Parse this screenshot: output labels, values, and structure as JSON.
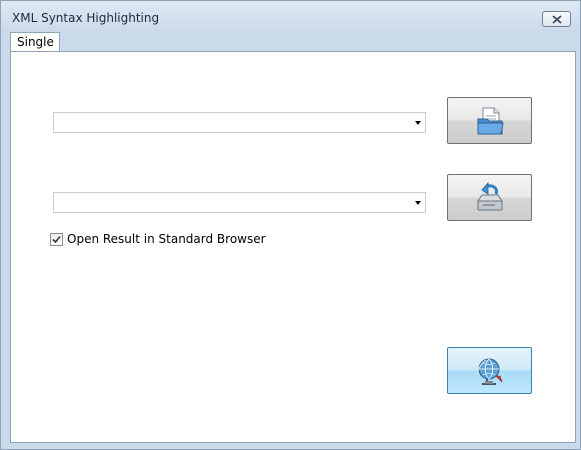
{
  "window": {
    "title": "XML Syntax Highlighting"
  },
  "tabs": [
    {
      "label": "Single",
      "selected": true
    }
  ],
  "form": {
    "input_file": {
      "value": ""
    },
    "output_file": {
      "value": ""
    },
    "open_browser": {
      "label": "Open Result in Standard Browser",
      "checked": true
    }
  },
  "icons": {
    "close": "close-icon",
    "open_folder": "open-folder-icon",
    "save_drive": "save-drive-icon",
    "globe_run": "globe-network-icon"
  },
  "colors": {
    "active_button": "#bde6fd",
    "window_frame": "#cbdaea"
  }
}
